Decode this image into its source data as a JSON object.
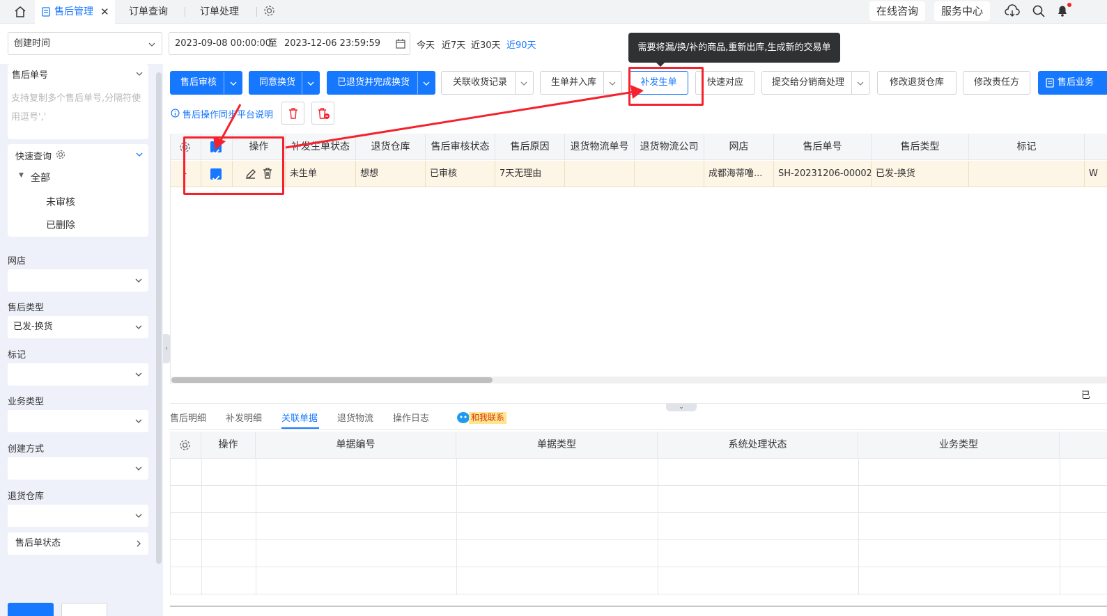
{
  "topbar": {
    "tabs": [
      {
        "label": "售后管理",
        "active": true
      },
      {
        "label": "订单查询"
      },
      {
        "label": "订单处理"
      }
    ],
    "online_consult": "在线咨询",
    "service_center": "服务中心"
  },
  "filter": {
    "time_field": "创建时间",
    "date_start": "2023-09-08 00:00:00",
    "date_to": "至",
    "date_end": "2023-12-06 23:59:59",
    "quick": [
      "今天",
      "近7天",
      "近30天",
      "近90天"
    ],
    "quick_active": "近90天"
  },
  "sidebar": {
    "order_no_label": "售后单号",
    "order_no_placeholder": "支持复制多个售后单号,分隔符使用逗号','",
    "quick_query": "快速查询",
    "tree_root": "全部",
    "tree_items": [
      "未审核",
      "已删除"
    ],
    "fields": [
      {
        "label": "网店",
        "value": ""
      },
      {
        "label": "售后类型",
        "value": "已发-换货"
      },
      {
        "label": "标记",
        "value": ""
      },
      {
        "label": "业务类型",
        "value": ""
      },
      {
        "label": "创建方式",
        "value": ""
      },
      {
        "label": "退货仓库",
        "value": ""
      }
    ],
    "status_label": "售后单状态"
  },
  "toolbar": {
    "buttons": [
      "售后审核",
      "同意换货",
      "已退货并完成换货",
      "关联收货记录",
      "生单并入库",
      "补发生单",
      "快速对应",
      "提交给分销商处理",
      "修改退货仓库",
      "修改责任方",
      "售后业务"
    ],
    "sync_note": "售后操作同步平台说明",
    "tooltip": "需要将漏/换/补的商品,重新出库,生成新的交易单"
  },
  "table": {
    "headers": [
      "操作",
      "补发生单状态",
      "退货仓库",
      "售后审核状态",
      "售后原因",
      "退货物流单号",
      "退货物流公司",
      "网店",
      "售后单号",
      "售后类型",
      "标记"
    ],
    "row": {
      "reissue_status": "未生单",
      "return_wh": "想想",
      "audit_status": "已审核",
      "reason": "7天无理由",
      "logistics_no": "",
      "logistics_co": "",
      "shop": "成都海蒂噜...",
      "order_no": "SH-20231206-00002",
      "type": "已发-换货",
      "mark": "",
      "extra": "W"
    },
    "footer_text": "已"
  },
  "detail": {
    "tabs": [
      "售后明细",
      "补发明细",
      "关联单据",
      "退货物流",
      "操作日志"
    ],
    "active_tab": "关联单据",
    "contact_badge": "和我联系",
    "headers": [
      "操作",
      "单据编号",
      "单据类型",
      "系统处理状态",
      "业务类型"
    ]
  }
}
